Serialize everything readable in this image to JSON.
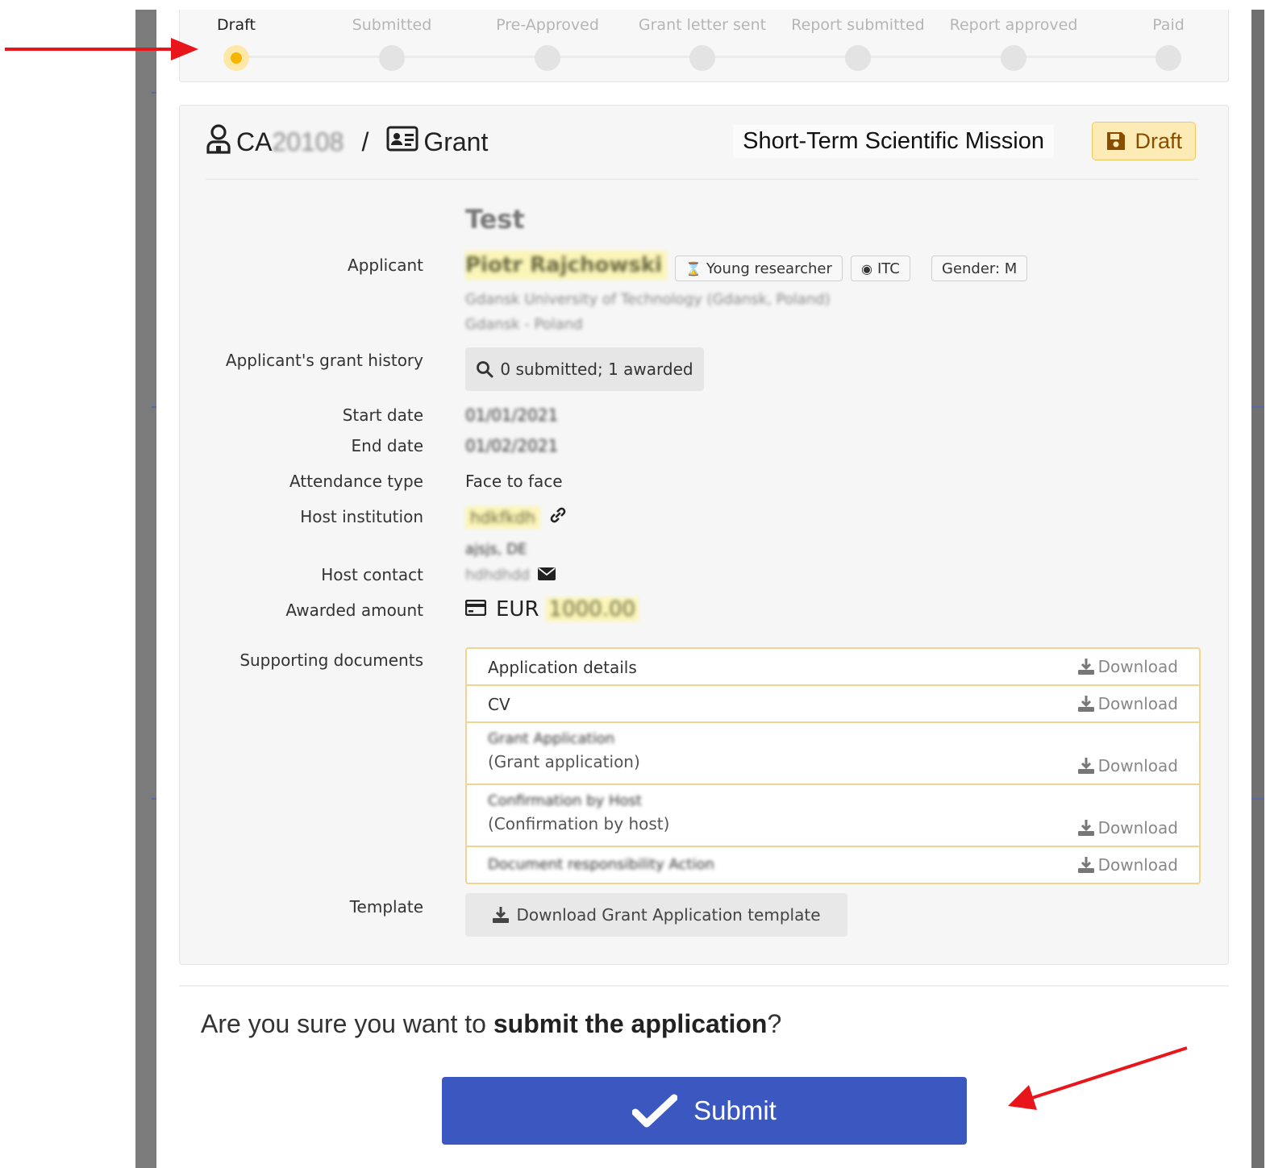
{
  "stepper": {
    "steps": [
      {
        "label": "Draft",
        "active": true
      },
      {
        "label": "Submitted",
        "active": false
      },
      {
        "label": "Pre-Approved",
        "active": false
      },
      {
        "label": "Grant letter sent",
        "active": false
      },
      {
        "label": "Report submitted",
        "active": false
      },
      {
        "label": "Report approved",
        "active": false
      },
      {
        "label": "Paid",
        "active": false
      }
    ]
  },
  "header": {
    "action_prefix": "CA",
    "action_code": "20108",
    "separator": "/",
    "type": "Grant",
    "mission": "Short-Term Scientific Mission",
    "status": "Draft"
  },
  "details": {
    "title": "Test",
    "applicant_label": "Applicant",
    "applicant_name": "Piotr Rajchowski",
    "chips": {
      "researcher": "Young researcher",
      "itc": "ITC",
      "gender": "Gender: M"
    },
    "affiliation_1": "Gdansk University of Technology (Gdansk, Poland)",
    "affiliation_2": "Gdansk - Poland",
    "history_label": "Applicant's grant history",
    "history_value": "0 submitted; 1 awarded",
    "start_label": "Start date",
    "start_value": "01/01/2021",
    "end_label": "End date",
    "end_value": "01/02/2021",
    "attendance_label": "Attendance type",
    "attendance_value": "Face to face",
    "host_inst_label": "Host institution",
    "host_inst_value": "hdkfkdh",
    "host_location": "ajsjs, DE",
    "host_contact_label": "Host contact",
    "host_contact_value": "hdhdhdd",
    "amount_label": "Awarded amount",
    "amount_currency": "EUR",
    "amount_value": "1000.00",
    "docs_label": "Supporting documents",
    "template_label": "Template",
    "template_button": "Download Grant Application template"
  },
  "documents": [
    {
      "title": "Application details",
      "subtitle": "",
      "download": "Download"
    },
    {
      "title": "CV",
      "subtitle": "",
      "download": "Download"
    },
    {
      "title": "Grant Application",
      "subtitle": "(Grant application)",
      "download": "Download"
    },
    {
      "title": "Confirmation by Host",
      "subtitle": "(Confirmation by host)",
      "download": "Download"
    },
    {
      "title": "Document responsibility Action",
      "subtitle": "",
      "download": "Download"
    }
  ],
  "confirm": {
    "question_prefix": "Are you sure you want to ",
    "question_bold": "submit the application",
    "question_suffix": "?",
    "submit_label": "Submit"
  },
  "colors": {
    "accent": "#3b57c0",
    "draft": "#f4b400",
    "arrow": "#e8161b"
  }
}
